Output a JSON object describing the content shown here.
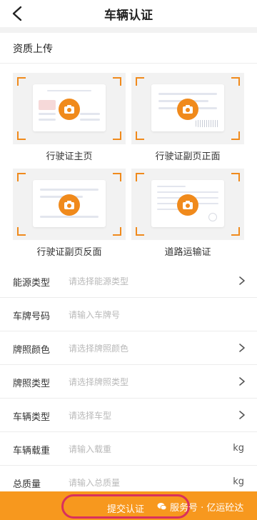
{
  "header": {
    "title": "车辆认证"
  },
  "section": {
    "title": "资质上传"
  },
  "uploads": [
    {
      "label": "行驶证主页"
    },
    {
      "label": "行驶证副页正面"
    },
    {
      "label": "行驶证副页反面"
    },
    {
      "label": "道路运输证"
    }
  ],
  "form": [
    {
      "label": "能源类型",
      "placeholder": "请选择能源类型",
      "trailing": "chevron"
    },
    {
      "label": "车牌号码",
      "placeholder": "请输入车牌号",
      "trailing": ""
    },
    {
      "label": "牌照颜色",
      "placeholder": "请选择牌照颜色",
      "trailing": "chevron"
    },
    {
      "label": "牌照类型",
      "placeholder": "请选择牌照类型",
      "trailing": "chevron"
    },
    {
      "label": "车辆类型",
      "placeholder": "请选择车型",
      "trailing": "chevron"
    },
    {
      "label": "车辆载重",
      "placeholder": "请输入载重",
      "trailing": "kg"
    },
    {
      "label": "总质量",
      "placeholder": "请输入总质量",
      "trailing": "kg"
    }
  ],
  "footer": {
    "submit_label": "提交认证",
    "watermark": "服务号 · 亿运砼达"
  },
  "colors": {
    "accent": "#f7981e",
    "highlight": "#d9305e"
  },
  "icons": [
    "back-arrow-icon",
    "camera-icon",
    "chevron-right-icon",
    "wechat-icon"
  ]
}
